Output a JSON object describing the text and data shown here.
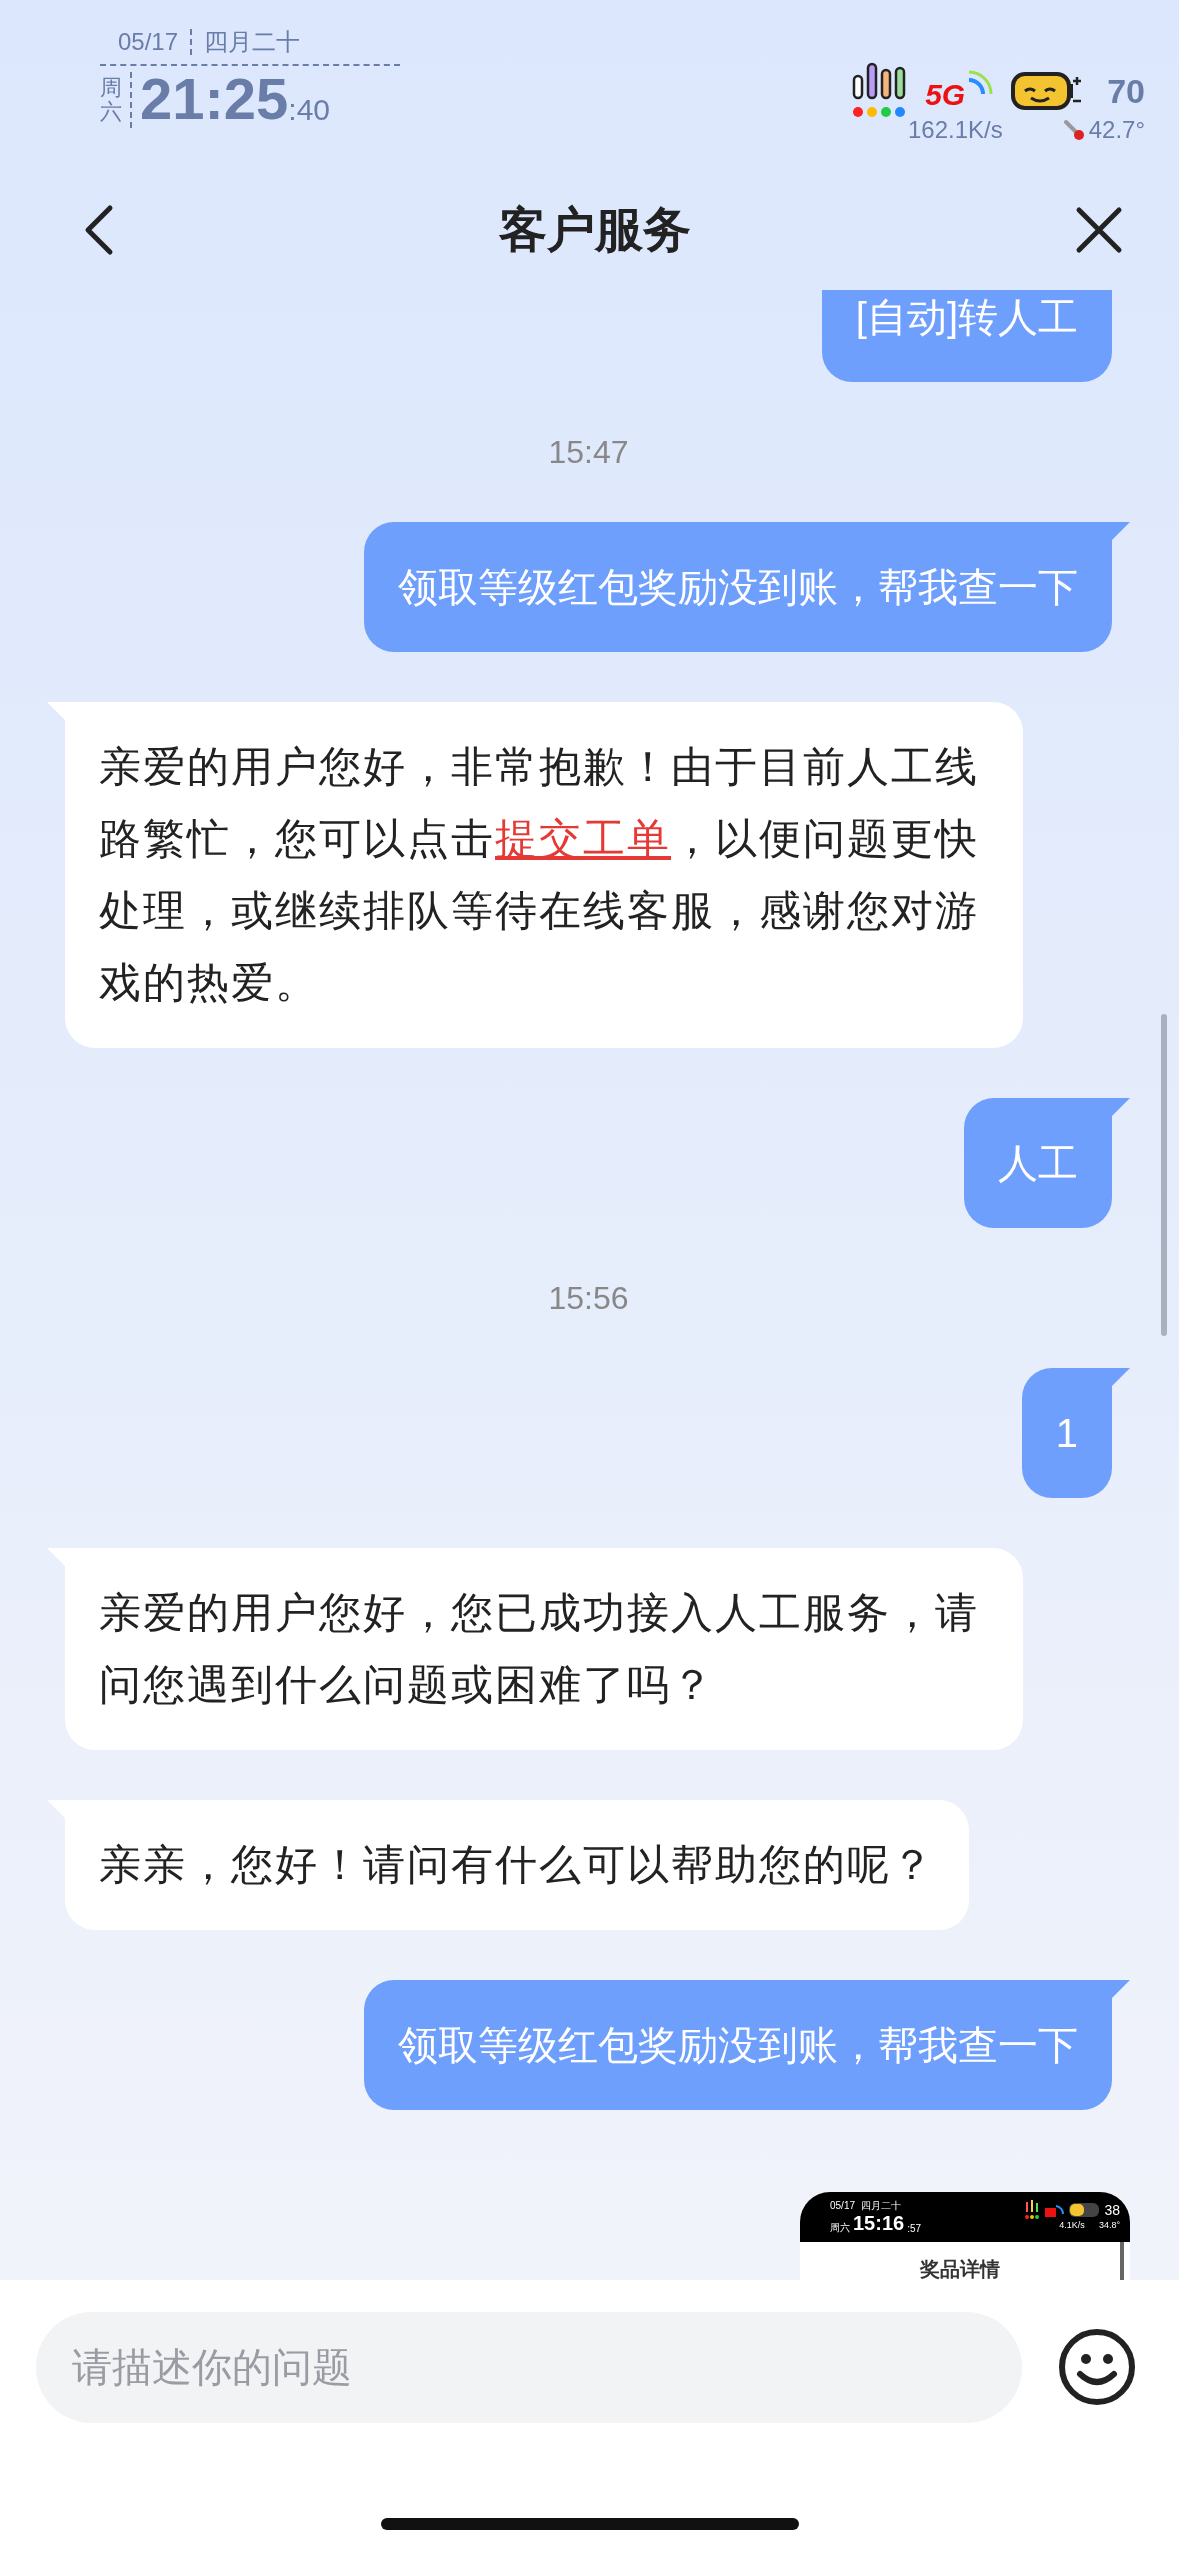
{
  "status_bar": {
    "date": "05/17",
    "lunar_date": "四月二十",
    "weekday": "周六",
    "time": "21:25",
    "seconds": ":40",
    "network_type": "5G",
    "battery": "70",
    "net_speed": "162.1K/s",
    "temperature": "42.7°"
  },
  "header": {
    "title": "客户服务"
  },
  "messages": [
    {
      "kind": "user",
      "text": "[自动]转人工"
    },
    {
      "kind": "time",
      "text": "15:47"
    },
    {
      "kind": "user",
      "text": "领取等级红包奖励没到账，帮我查一下"
    },
    {
      "kind": "agent",
      "parts": [
        {
          "kind": "text",
          "text": "亲爱的用户您好，非常抱歉！由于目前人工线路繁忙，您可以点击"
        },
        {
          "kind": "link",
          "text": "提交工单"
        },
        {
          "kind": "text",
          "text": "，以便问题更快处理，或继续排队等待在线客服，感谢您对游戏的热爱。"
        }
      ]
    },
    {
      "kind": "user",
      "text": "人工"
    },
    {
      "kind": "time",
      "text": "15:56"
    },
    {
      "kind": "user",
      "text": "1"
    },
    {
      "kind": "agent",
      "parts": [
        {
          "kind": "text",
          "text": "亲爱的用户您好，您已成功接入人工服务，请问您遇到什么问题或困难了吗？"
        }
      ]
    },
    {
      "kind": "agent",
      "parts": [
        {
          "kind": "text",
          "text": "亲亲，您好！请问有什么可以帮助您的呢？"
        }
      ]
    },
    {
      "kind": "user",
      "text": "领取等级红包奖励没到账，帮我查一下"
    },
    {
      "kind": "image",
      "screenshot": {
        "date": "05/17",
        "lunar_date": "四月二十",
        "weekday": "周六",
        "time": "15:16",
        "seconds": ":57",
        "net_speed": "4.1K/s",
        "battery": "38",
        "temperature": "34.8°",
        "title": "奖品详情"
      }
    }
  ],
  "input": {
    "placeholder": "请描述你的问题"
  }
}
